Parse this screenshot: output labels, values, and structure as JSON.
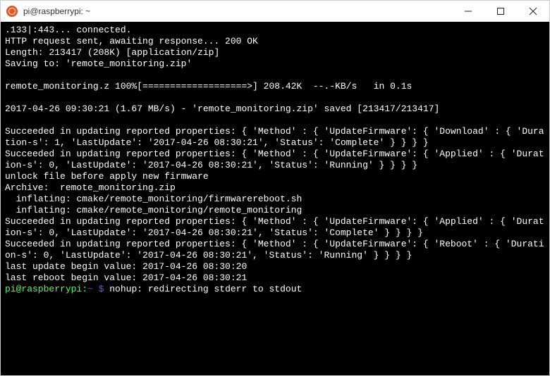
{
  "window": {
    "title": "pi@raspberrypi: ~"
  },
  "terminal": {
    "lines": [
      ".133|:443... connected.",
      "HTTP request sent, awaiting response... 200 OK",
      "Length: 213417 (208K) [application/zip]",
      "Saving to: 'remote_monitoring.zip'",
      "",
      "remote_monitoring.z 100%[===================>] 208.42K  --.-KB/s   in 0.1s",
      "",
      "2017-04-26 09:30:21 (1.67 MB/s) - 'remote_monitoring.zip' saved [213417/213417]",
      "",
      "Succeeded in updating reported properties: { 'Method' : { 'UpdateFirmware': { 'Download' : { 'Duration-s': 1, 'LastUpdate': '2017-04-26 08:30:21', 'Status': 'Complete' } } } }",
      "Succeeded in updating reported properties: { 'Method' : { 'UpdateFirmware': { 'Applied' : { 'Duration-s': 0, 'LastUpdate': '2017-04-26 08:30:21', 'Status': 'Running' } } } }",
      "unlock file before apply new firmware",
      "Archive:  remote_monitoring.zip",
      "  inflating: cmake/remote_monitoring/firmwarereboot.sh",
      "  inflating: cmake/remote_monitoring/remote_monitoring",
      "Succeeded in updating reported properties: { 'Method' : { 'UpdateFirmware': { 'Applied' : { 'Duration-s': 0, 'LastUpdate': '2017-04-26 08:30:21', 'Status': 'Complete' } } } }",
      "Succeeded in updating reported properties: { 'Method' : { 'UpdateFirmware': { 'Reboot' : { 'Duration-s': 0, 'LastUpdate': '2017-04-26 08:30:21', 'Status': 'Running' } } } }",
      "last update begin value: 2017-04-26 08:30:20",
      "last reboot begin value: 2017-04-26 08:30:21"
    ],
    "prompt": {
      "user_host": "pi@raspberrypi",
      "sep": ":",
      "path": "~ $ ",
      "command": "nohup: redirecting stderr to stdout"
    }
  }
}
